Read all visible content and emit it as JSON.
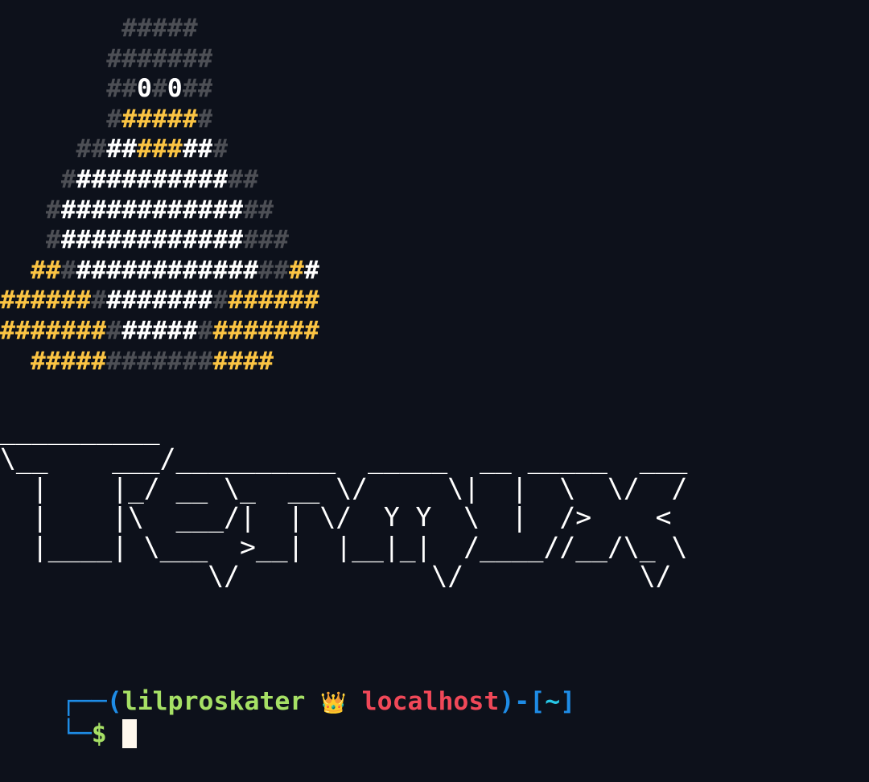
{
  "terminal": {
    "background": "#0d111b",
    "colors": {
      "d": "#4d4f55",
      "w": "#ffffff",
      "y": "#fbc443",
      "prompt_blue": "#1e8ce6",
      "prompt_green": "#a6e065",
      "prompt_red": "#f04858",
      "prompt_cyan": "#27c7e6"
    },
    "tux_art": [
      {
        "text": "        #####",
        "colors": "        ddddd"
      },
      {
        "text": "       #######",
        "colors": "       ddddddd"
      },
      {
        "text": "       ##0#0##",
        "colors": "       ddwdwdd"
      },
      {
        "text": "       #######",
        "colors": "       dyyyyyd"
      },
      {
        "text": "     ##########",
        "colors": "     ddwwyyywwdd"
      },
      {
        "text": "    #############",
        "colors": "    dwwwwwwwwwwdd"
      },
      {
        "text": "   ###############",
        "colors": "   dwwwwwwwwwwwwdd"
      },
      {
        "text": "   ################",
        "colors": "   dwwwwwwwwwwwwddd"
      },
      {
        "text": "  ###################",
        "colors": "  yydwwwwwwwwwwwwddy"
      },
      {
        "text": "#####################",
        "colors": "yyyyyydwwwwwwwdyyyyyy"
      },
      {
        "text": "#####################",
        "colors": "yyyyyyydwwwwwdyyyyyyy"
      },
      {
        "text": "  ################",
        "colors": "  yyyyydddddddyyyyy"
      }
    ],
    "banner_art": [
      "__________",
      "\\__    ___/__________  _____  __ _____  ___",
      "  |    |_/ __ \\_  __ \\/     \\|  |  \\  \\/  /",
      "  |    |\\  ___/|  | \\/  Y Y  \\  |  />    <",
      "  |____| \\___  >__|  |__|_|  /____//__/\\_ \\",
      "             \\/            \\/           \\/"
    ],
    "prompt": {
      "corner_top": "┌──",
      "open_paren": "(",
      "user": "lilproskater",
      "crown_icon": "👑",
      "host": "localhost",
      "close_paren": ")",
      "dash": "-",
      "open_bracket": "[",
      "cwd": "~",
      "close_bracket": "]",
      "corner_bottom": "└─",
      "symbol": "$"
    }
  }
}
